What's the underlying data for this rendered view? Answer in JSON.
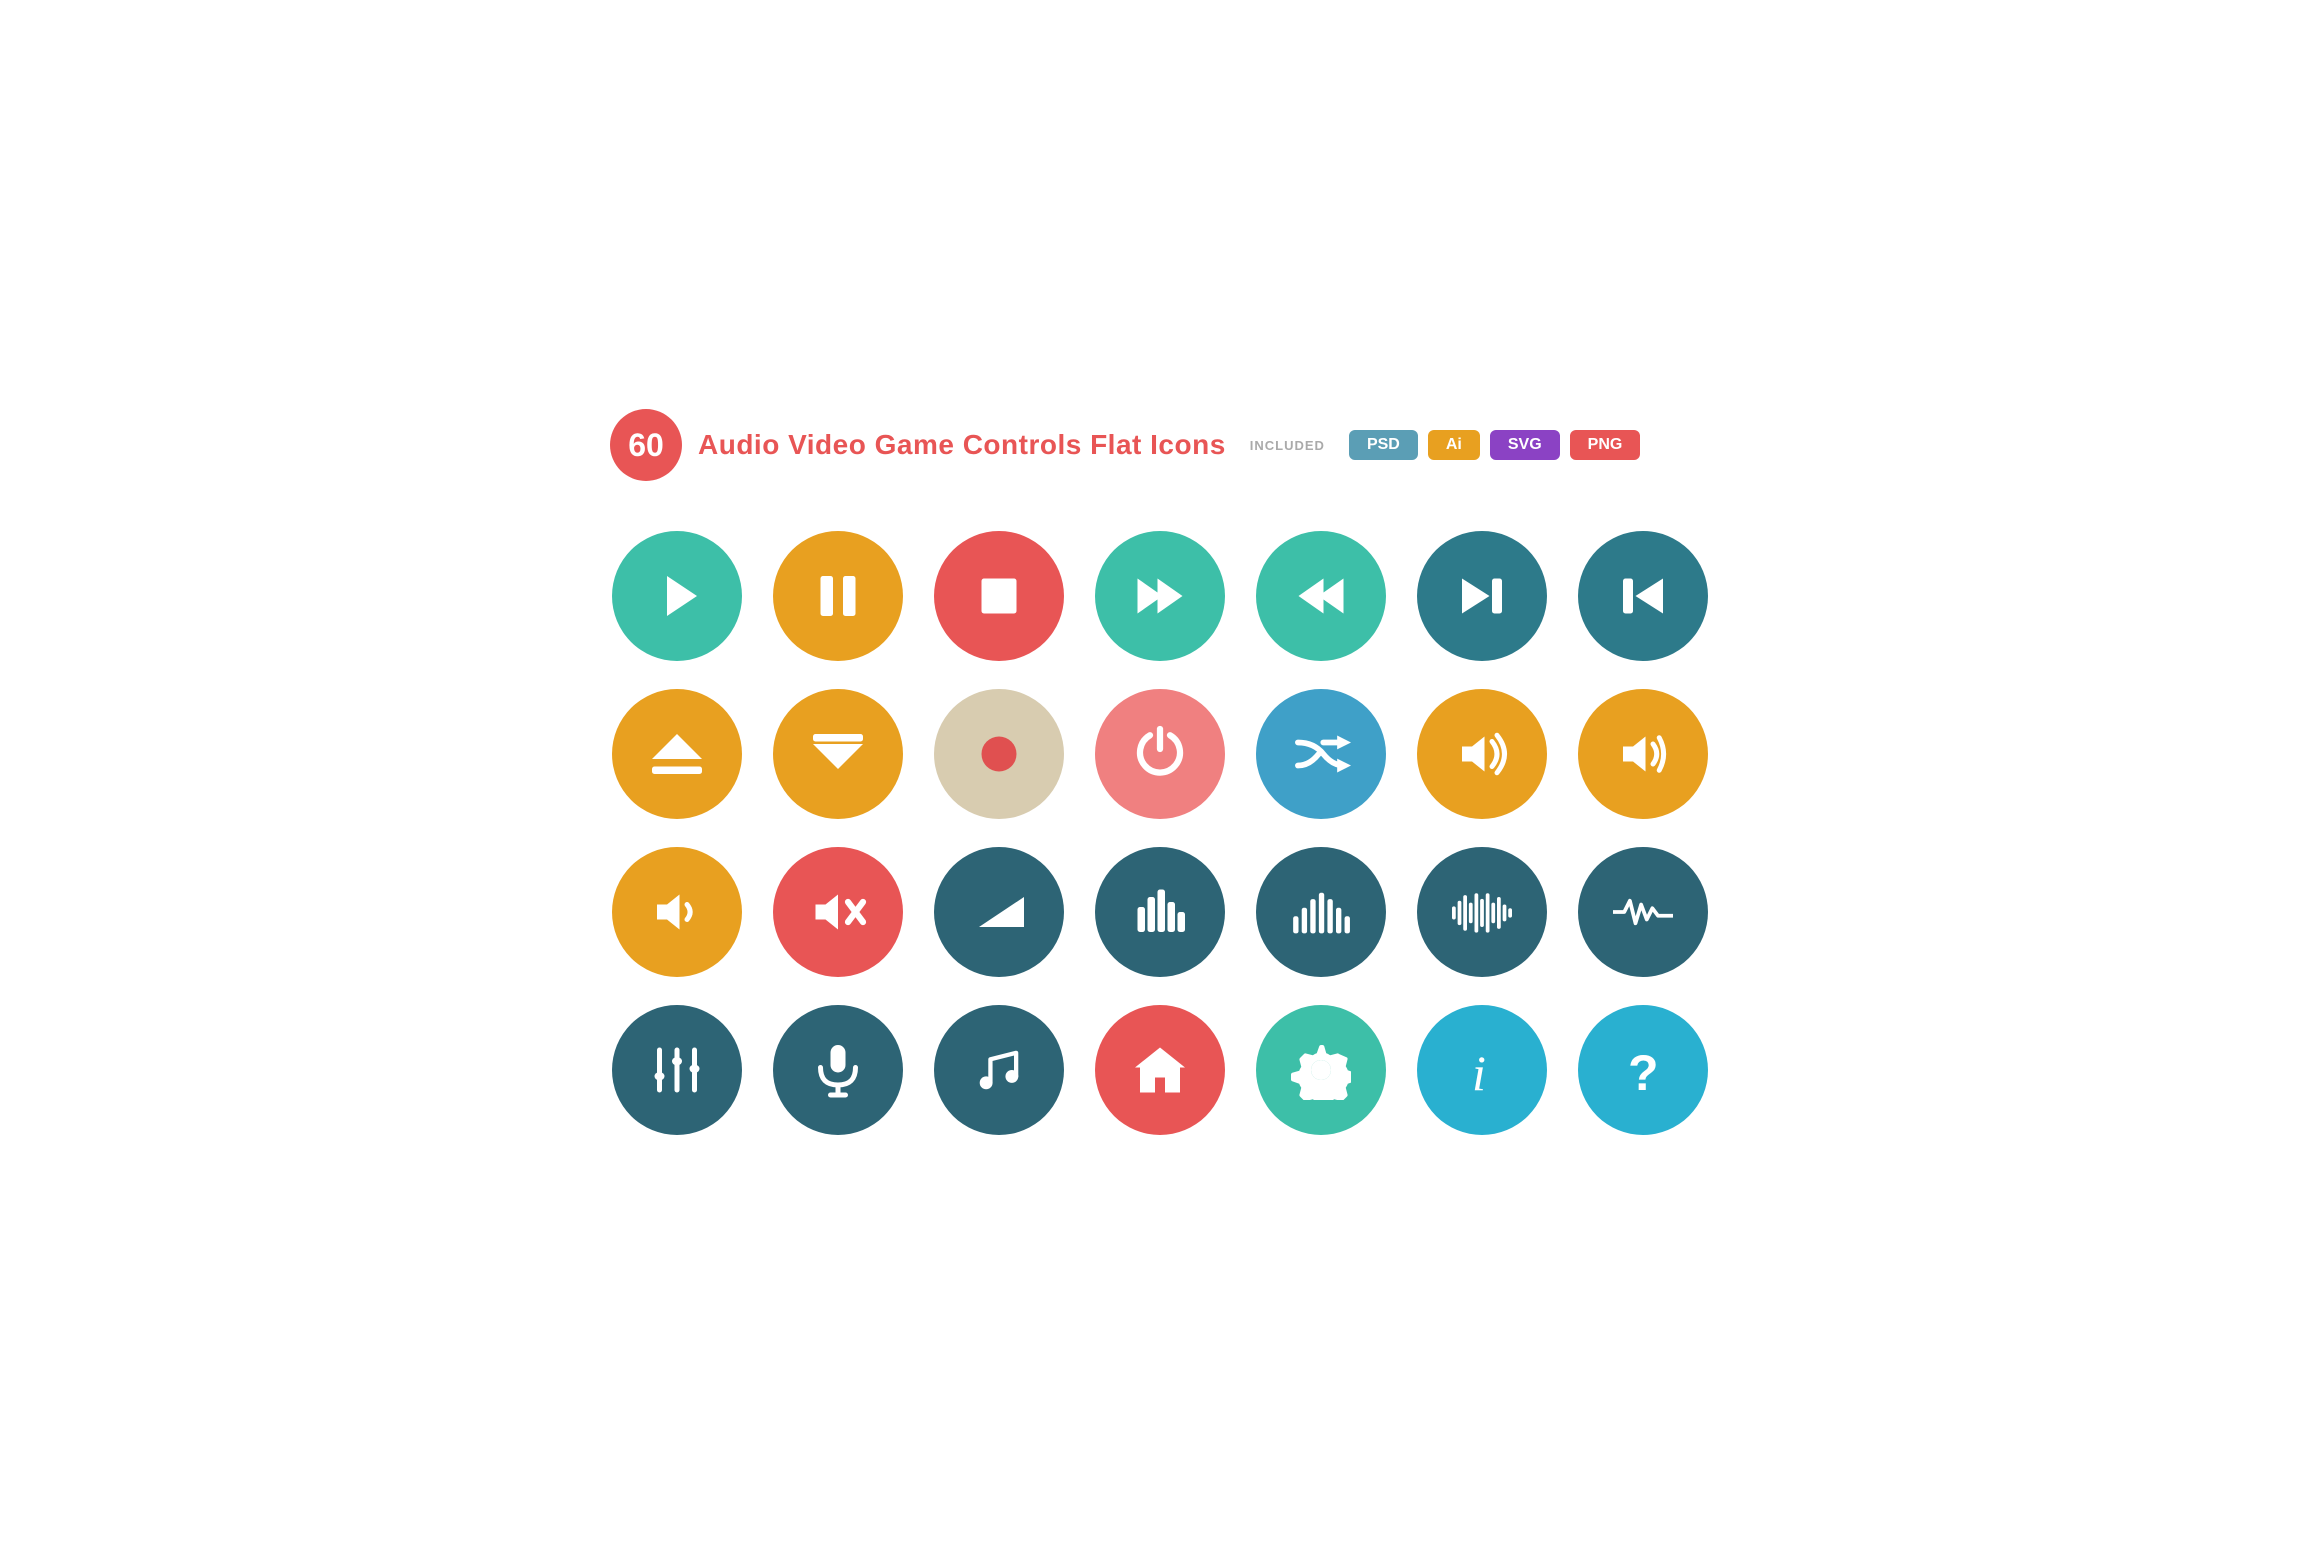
{
  "header": {
    "number": "60",
    "title": "Audio Video Game Controls Flat Icons",
    "included_label": "INCLUDED",
    "formats": [
      {
        "label": "PSD",
        "class": "badge-psd"
      },
      {
        "label": "Ai",
        "class": "badge-ai"
      },
      {
        "label": "SVG",
        "class": "badge-svg"
      },
      {
        "label": "PNG",
        "class": "badge-png"
      }
    ]
  },
  "icons": [
    {
      "name": "play",
      "color": "teal",
      "symbol": "play"
    },
    {
      "name": "pause",
      "color": "yellow",
      "symbol": "pause"
    },
    {
      "name": "stop",
      "color": "coral",
      "symbol": "stop"
    },
    {
      "name": "fast-forward",
      "color": "teal",
      "symbol": "fast-forward"
    },
    {
      "name": "rewind",
      "color": "teal",
      "symbol": "rewind"
    },
    {
      "name": "next-track",
      "color": "dark-teal",
      "symbol": "next-track"
    },
    {
      "name": "prev-track",
      "color": "dark-teal",
      "symbol": "prev-track"
    },
    {
      "name": "eject",
      "color": "yellow",
      "symbol": "eject"
    },
    {
      "name": "download",
      "color": "yellow",
      "symbol": "download"
    },
    {
      "name": "record",
      "color": "beige",
      "symbol": "record"
    },
    {
      "name": "power",
      "color": "light-coral",
      "symbol": "power"
    },
    {
      "name": "shuffle",
      "color": "blue",
      "symbol": "shuffle"
    },
    {
      "name": "volume-high",
      "color": "yellow",
      "symbol": "volume-high"
    },
    {
      "name": "volume-med",
      "color": "yellow",
      "symbol": "volume-med"
    },
    {
      "name": "volume-low",
      "color": "yellow",
      "symbol": "volume-low"
    },
    {
      "name": "volume-mute",
      "color": "coral",
      "symbol": "volume-mute"
    },
    {
      "name": "volume-ramp",
      "color": "dark-slate",
      "symbol": "volume-ramp"
    },
    {
      "name": "equalizer",
      "color": "dark-slate",
      "symbol": "equalizer"
    },
    {
      "name": "soundbars",
      "color": "dark-slate",
      "symbol": "soundbars"
    },
    {
      "name": "waveform",
      "color": "dark-slate",
      "symbol": "waveform"
    },
    {
      "name": "heartbeat",
      "color": "dark-slate",
      "symbol": "heartbeat"
    },
    {
      "name": "mixer",
      "color": "dark-slate",
      "symbol": "mixer"
    },
    {
      "name": "microphone",
      "color": "dark-slate",
      "symbol": "microphone"
    },
    {
      "name": "music-note",
      "color": "dark-slate",
      "symbol": "music-note"
    },
    {
      "name": "home",
      "color": "coral",
      "symbol": "home"
    },
    {
      "name": "settings",
      "color": "teal2",
      "symbol": "settings"
    },
    {
      "name": "info",
      "color": "cyan",
      "symbol": "info"
    },
    {
      "name": "help",
      "color": "cyan",
      "symbol": "help"
    }
  ]
}
